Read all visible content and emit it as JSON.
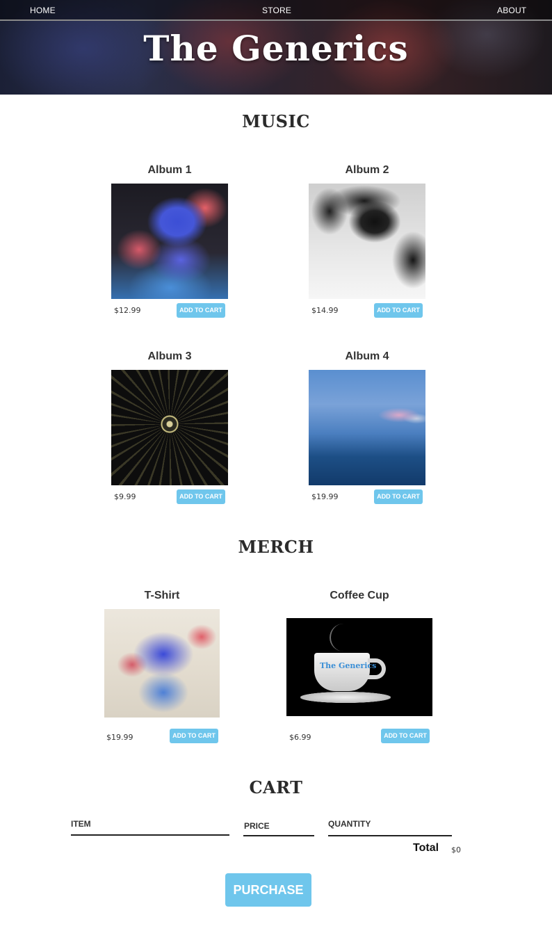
{
  "nav": {
    "home": "HOME",
    "store": "STORE",
    "about": "ABOUT"
  },
  "brand": "The Generics",
  "music": {
    "title": "MUSIC",
    "albums": [
      {
        "title": "Album 1",
        "price": "$12.99",
        "button": "ADD TO CART"
      },
      {
        "title": "Album 2",
        "price": "$14.99",
        "button": "ADD TO CART"
      },
      {
        "title": "Album 3",
        "price": "$9.99",
        "button": "ADD TO CART"
      },
      {
        "title": "Album 4",
        "price": "$19.99",
        "button": "ADD TO CART"
      }
    ]
  },
  "merch": {
    "title": "MERCH",
    "items": [
      {
        "title": "T-Shirt",
        "price": "$19.99",
        "button": "ADD TO CART"
      },
      {
        "title": "Coffee Cup",
        "price": "$6.99",
        "button": "ADD TO CART",
        "logo_text": "The Generics"
      }
    ]
  },
  "cart": {
    "title": "CART",
    "columns": {
      "item": "ITEM",
      "price": "PRICE",
      "quantity": "QUANTITY"
    },
    "total_label": "Total",
    "total_value": "$0",
    "purchase_label": "PURCHASE"
  },
  "colors": {
    "accent": "#6fc6ec",
    "text": "#333333"
  }
}
